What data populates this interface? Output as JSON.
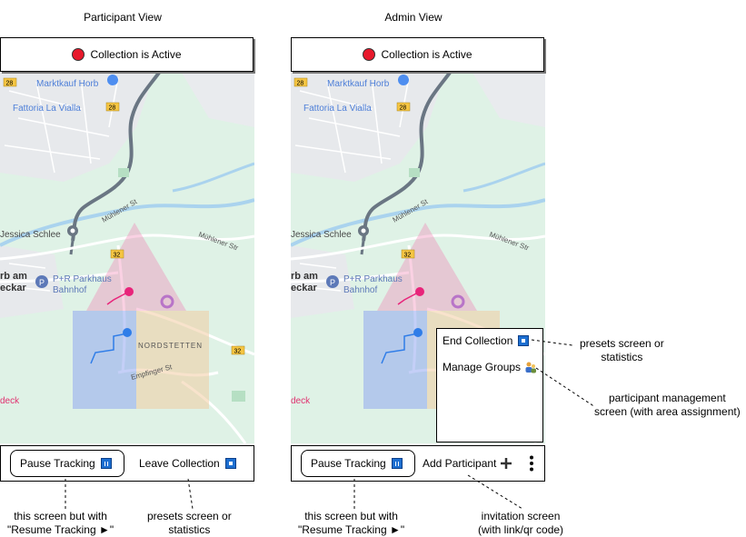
{
  "participant_view": {
    "title": "Participant View",
    "status": "Collection is Active",
    "pause_label": "Pause Tracking",
    "leave_label": "Leave Collection"
  },
  "admin_view": {
    "title": "Admin View",
    "status": "Collection is Active",
    "pause_label": "Pause Tracking",
    "add_participant_label": "Add Participant",
    "menu": {
      "end_collection": "End Collection",
      "manage_groups": "Manage Groups"
    }
  },
  "map": {
    "labels": {
      "marktkauf": "Marktkauf Horb",
      "fattoria": "Fattoria La Vialla",
      "jessica": "Jessica Schlee",
      "horb_line1": "rb am",
      "horb_line2": "eckar",
      "parkhaus_line1": "P+R Parkhaus",
      "parkhaus_line2": "Bahnhof",
      "nordstetten": "NORDSTETTEN",
      "muhlener1": "Mühlener St",
      "muhlener2": "Mühlener Str",
      "empfinger": "Empfinger St",
      "deck": "deck",
      "route28a": "28",
      "route28b": "28",
      "route32a": "32",
      "route32b": "32"
    },
    "colors": {
      "land": "#dff2e6",
      "water": "#aad3ee",
      "road": "#6a7683",
      "pink_zone": "#f07ab0",
      "blue_zone": "#8aa0f0",
      "orange_zone": "#f2c89a",
      "marker_pink": "#e8247a",
      "marker_blue": "#2f7de8"
    }
  },
  "annotations": {
    "resume_left": [
      "this screen but with",
      "\"Resume Tracking ►\""
    ],
    "presets_left": [
      "presets screen or",
      "statistics"
    ],
    "resume_right": [
      "this screen but with",
      "\"Resume Tracking ►\""
    ],
    "invitation": [
      "invitation screen",
      "(with link/qr code)"
    ],
    "presets_right": [
      "presets screen or",
      "statistics"
    ],
    "participant_mgmt": [
      "participant management",
      "screen (with area assignment)"
    ]
  }
}
